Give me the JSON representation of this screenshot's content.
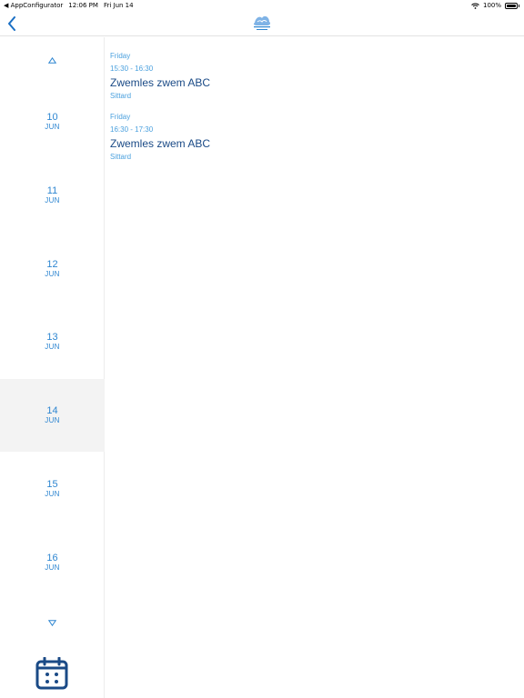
{
  "status_bar": {
    "back_app": "◀ AppConfigurator",
    "time": "12:06 PM",
    "date": "Fri Jun 14",
    "battery": "100%"
  },
  "nav": {
    "back_icon": "chevron-left-icon",
    "logo_icon": "club-logo-icon"
  },
  "rail": {
    "up_icon": "triangle-up-icon",
    "down_icon": "triangle-down-icon",
    "days": [
      {
        "day": "10",
        "month": "JUN"
      },
      {
        "day": "11",
        "month": "JUN"
      },
      {
        "day": "12",
        "month": "JUN"
      },
      {
        "day": "13",
        "month": "JUN"
      },
      {
        "day": "14",
        "month": "JUN"
      },
      {
        "day": "15",
        "month": "JUN"
      },
      {
        "day": "16",
        "month": "JUN"
      }
    ],
    "selected_index": 4,
    "calendar_icon": "calendar-icon"
  },
  "events": [
    {
      "weekday": "Friday",
      "time": "15:30  -  16:30",
      "title": "Zwemles zwem ABC",
      "location": "Sittard"
    },
    {
      "weekday": "Friday",
      "time": "16:30  -  17:30",
      "title": "Zwemles zwem ABC",
      "location": "Sittard"
    }
  ],
  "colors": {
    "accent": "#2e86d1",
    "title": "#1a4a86",
    "selected_bg": "#f3f3f3"
  }
}
